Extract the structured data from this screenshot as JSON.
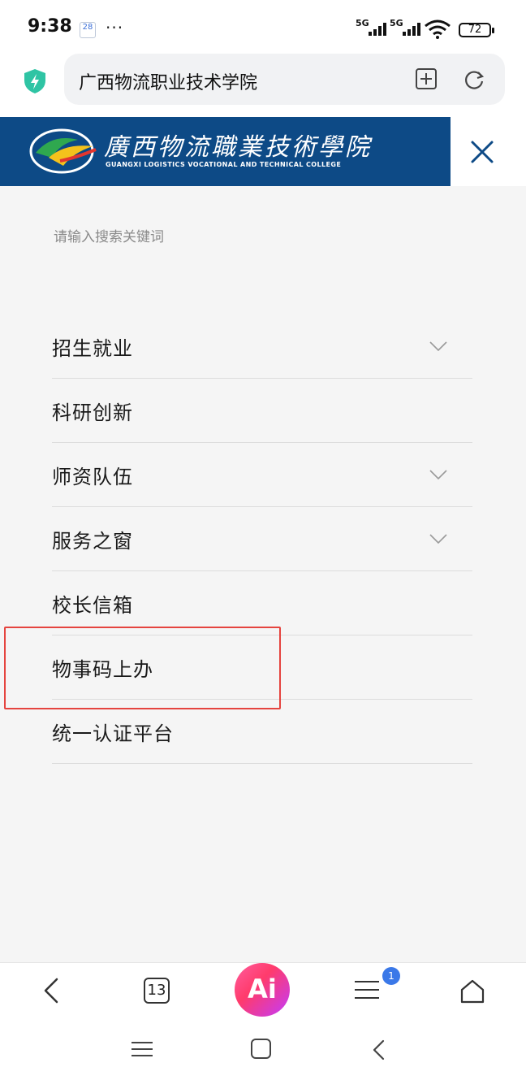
{
  "status_bar": {
    "time": "9:38",
    "calendar_day": "28",
    "overflow": "···",
    "signal1_label": "5G",
    "signal2_label": "5G",
    "battery": "72"
  },
  "address_bar": {
    "title": "广西物流职业技术学院"
  },
  "site_header": {
    "logo_cn": "廣西物流職業技術學院",
    "logo_en": "GUANGXI LOGISTICS VOCATIONAL AND TECHNICAL COLLEGE"
  },
  "menu": {
    "search_placeholder": "请输入搜索关键词",
    "items": [
      {
        "label": "招生就业",
        "has_submenu": true
      },
      {
        "label": "科研创新",
        "has_submenu": false
      },
      {
        "label": "师资队伍",
        "has_submenu": true
      },
      {
        "label": "服务之窗",
        "has_submenu": true
      },
      {
        "label": "校长信箱",
        "has_submenu": false
      },
      {
        "label": "物事码上办",
        "has_submenu": false
      },
      {
        "label": "统一认证平台",
        "has_submenu": false
      }
    ]
  },
  "bottom_toolbar": {
    "tab_count": "13",
    "ai_label": "Ai",
    "menu_badge": "1"
  },
  "colors": {
    "header_blue": "#0d4a86",
    "highlight_red": "#e5443f",
    "panel_bg": "#f5f5f5",
    "badge_blue": "#3a78e8"
  }
}
